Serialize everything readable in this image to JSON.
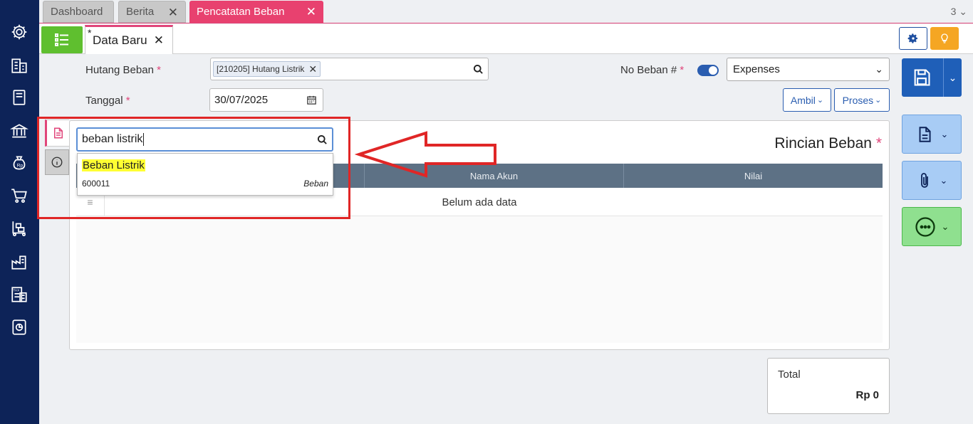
{
  "sidebar": {
    "icons": [
      "gear-icon",
      "building-icon",
      "book-icon",
      "bank-icon",
      "money-bag-icon",
      "cart-icon",
      "trolley-icon",
      "factory-icon",
      "tax-icon",
      "report-icon"
    ]
  },
  "tabs": [
    {
      "label": "Dashboard",
      "active": false,
      "closable": false
    },
    {
      "label": "Berita",
      "active": false,
      "closable": true
    },
    {
      "label": "Pencatatan Beban",
      "active": true,
      "closable": true
    }
  ],
  "tab_count": "3",
  "doc_tab": {
    "modified_mark": "*",
    "label": "Data Baru"
  },
  "form": {
    "hutang_label": "Hutang Beban",
    "hutang_chip": "[210205] Hutang Listrik",
    "tanggal_label": "Tanggal",
    "tanggal_value": "30/07/2025",
    "no_beban_label": "No Beban #",
    "required_mark": "*",
    "expenses_select": "Expenses",
    "ambil_label": "Ambil",
    "proses_label": "Proses"
  },
  "panel": {
    "title": "Rincian Beban",
    "columns": [
      "",
      "Nama Akun",
      "Nilai"
    ],
    "empty_text": "Belum ada data"
  },
  "search": {
    "value": "beban listrik",
    "result": {
      "name": "Beban Listrik",
      "code": "600011",
      "type": "Beban"
    }
  },
  "total": {
    "label": "Total",
    "value": "Rp 0"
  },
  "colors": {
    "sidebar": "#0d2358",
    "accent": "#e8416f",
    "menu_green": "#5fbf2f",
    "save_blue": "#1f5fb8",
    "annotation_red": "#e02626"
  }
}
